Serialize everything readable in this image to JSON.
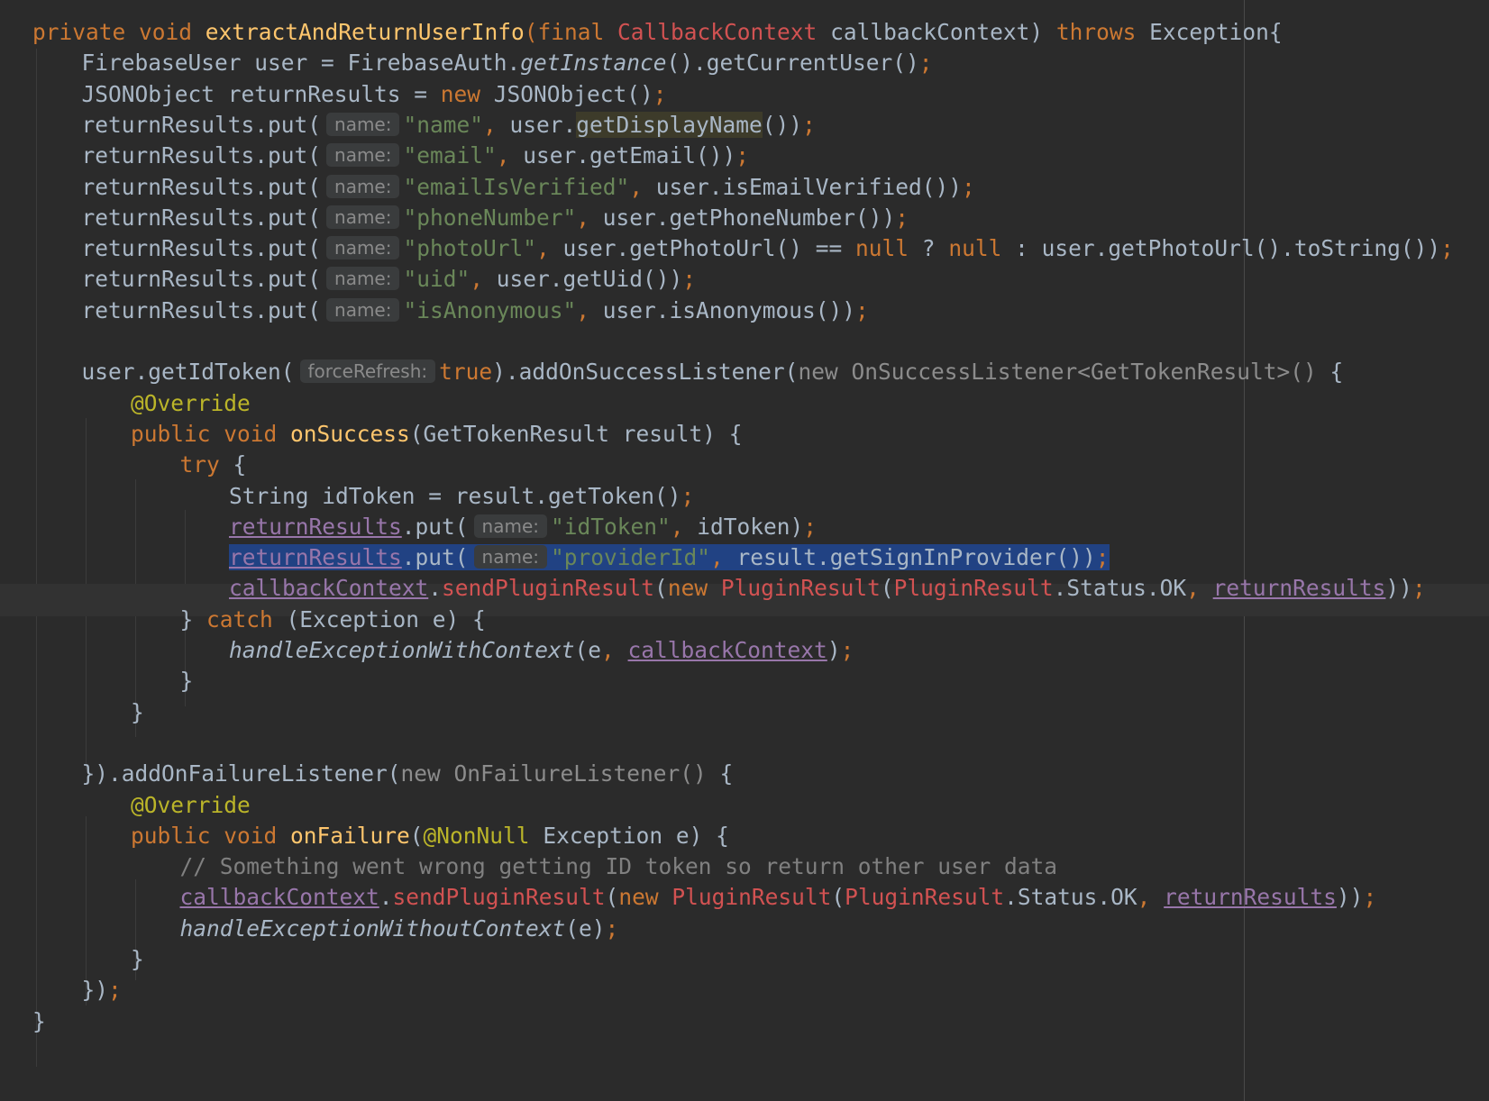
{
  "editor": {
    "language": "java",
    "lines": [
      [
        {
          "s": "kw",
          "v": "private void "
        },
        {
          "s": "fn",
          "v": "extractAndReturnUserInfo"
        },
        {
          "s": "kw",
          "v": "(final "
        },
        {
          "s": "cls",
          "v": "CallbackContext"
        },
        {
          "s": "def",
          "v": " callbackContext) "
        },
        {
          "s": "kw",
          "v": "throws "
        },
        {
          "s": "def",
          "v": "Exception{"
        }
      ],
      [
        {
          "s": "def",
          "v": "FirebaseUser user = FirebaseAuth."
        },
        {
          "s": "ital",
          "v": "getInstance"
        },
        {
          "s": "def",
          "v": "().getCurrentUser()"
        },
        {
          "s": "kw",
          "v": ";"
        }
      ],
      [
        {
          "s": "def",
          "v": "JSONObject returnResults = "
        },
        {
          "s": "kw",
          "v": "new "
        },
        {
          "s": "def",
          "v": "JSONObject()"
        },
        {
          "s": "kw",
          "v": ";"
        }
      ],
      [
        {
          "s": "def",
          "v": "returnResults.put("
        },
        {
          "s": "hint",
          "v": "name:"
        },
        {
          "s": "str",
          "v": "\"name\""
        },
        {
          "s": "kw",
          "v": ", "
        },
        {
          "s": "def",
          "v": "user."
        },
        {
          "s": "usage",
          "v": "getDisplayName"
        },
        {
          "s": "def",
          "v": "())"
        },
        {
          "s": "kw",
          "v": ";"
        }
      ],
      [
        {
          "s": "def",
          "v": "returnResults.put("
        },
        {
          "s": "hint",
          "v": "name:"
        },
        {
          "s": "str",
          "v": "\"email\""
        },
        {
          "s": "kw",
          "v": ", "
        },
        {
          "s": "def",
          "v": "user.getEmail())"
        },
        {
          "s": "kw",
          "v": ";"
        }
      ],
      [
        {
          "s": "def",
          "v": "returnResults.put("
        },
        {
          "s": "hint",
          "v": "name:"
        },
        {
          "s": "str",
          "v": "\"emailIsVerified\""
        },
        {
          "s": "kw",
          "v": ", "
        },
        {
          "s": "def",
          "v": "user.isEmailVerified())"
        },
        {
          "s": "kw",
          "v": ";"
        }
      ],
      [
        {
          "s": "def",
          "v": "returnResults.put("
        },
        {
          "s": "hint",
          "v": "name:"
        },
        {
          "s": "str",
          "v": "\"phoneNumber\""
        },
        {
          "s": "kw",
          "v": ", "
        },
        {
          "s": "def",
          "v": "user.getPhoneNumber())"
        },
        {
          "s": "kw",
          "v": ";"
        }
      ],
      [
        {
          "s": "def",
          "v": "returnResults.put("
        },
        {
          "s": "hint",
          "v": "name:"
        },
        {
          "s": "str",
          "v": "\"photoUrl\""
        },
        {
          "s": "kw",
          "v": ", "
        },
        {
          "s": "def",
          "v": "user.getPhotoUrl() == "
        },
        {
          "s": "kw",
          "v": "null "
        },
        {
          "s": "def",
          "v": "? "
        },
        {
          "s": "kw",
          "v": "null "
        },
        {
          "s": "def",
          "v": ": user.getPhotoUrl().toString())"
        },
        {
          "s": "kw",
          "v": ";"
        }
      ],
      [
        {
          "s": "def",
          "v": "returnResults.put("
        },
        {
          "s": "hint",
          "v": "name:"
        },
        {
          "s": "str",
          "v": "\"uid\""
        },
        {
          "s": "kw",
          "v": ", "
        },
        {
          "s": "def",
          "v": "user.getUid())"
        },
        {
          "s": "kw",
          "v": ";"
        }
      ],
      [
        {
          "s": "def",
          "v": "returnResults.put("
        },
        {
          "s": "hint",
          "v": "name:"
        },
        {
          "s": "str",
          "v": "\"isAnonymous\""
        },
        {
          "s": "kw",
          "v": ", "
        },
        {
          "s": "def",
          "v": "user.isAnonymous())"
        },
        {
          "s": "kw",
          "v": ";"
        }
      ],
      [],
      [
        {
          "s": "def",
          "v": "user.getIdToken("
        },
        {
          "s": "hint",
          "v": "forceRefresh:"
        },
        {
          "s": "kw",
          "v": "true"
        },
        {
          "s": "def",
          "v": ").addOnSuccessListener("
        },
        {
          "s": "dim",
          "v": "new OnSuccessListener<GetTokenResult>() "
        },
        {
          "s": "def",
          "v": "{"
        }
      ],
      [
        {
          "s": "ann",
          "v": "@Override"
        }
      ],
      [
        {
          "s": "kw",
          "v": "public void "
        },
        {
          "s": "fn",
          "v": "onSuccess"
        },
        {
          "s": "def",
          "v": "(GetTokenResult result) {"
        }
      ],
      [
        {
          "s": "kw",
          "v": "try "
        },
        {
          "s": "def",
          "v": "{"
        }
      ],
      [
        {
          "s": "def",
          "v": "String idToken = result.getToken()"
        },
        {
          "s": "kw",
          "v": ";"
        }
      ],
      [
        {
          "s": "field",
          "v": "returnResults"
        },
        {
          "s": "def",
          "v": ".put("
        },
        {
          "s": "hint",
          "v": "name:"
        },
        {
          "s": "str",
          "v": "\"idToken\""
        },
        {
          "s": "kw",
          "v": ", "
        },
        {
          "s": "def",
          "v": "idToken)"
        },
        {
          "s": "kw",
          "v": ";"
        }
      ],
      [
        {
          "s": "field",
          "v": "returnResults"
        },
        {
          "s": "def",
          "v": ".put("
        },
        {
          "s": "hint",
          "v": "name:"
        },
        {
          "s": "str",
          "v": "\"providerId\""
        },
        {
          "s": "kw",
          "v": ", "
        },
        {
          "s": "def",
          "v": "result.getSignInProvider())"
        },
        {
          "s": "kw",
          "v": ";"
        }
      ],
      [
        {
          "s": "field",
          "v": "callbackContext"
        },
        {
          "s": "def",
          "v": "."
        },
        {
          "s": "cls",
          "v": "sendPluginResult"
        },
        {
          "s": "def",
          "v": "("
        },
        {
          "s": "kw",
          "v": "new "
        },
        {
          "s": "cls",
          "v": "PluginResult"
        },
        {
          "s": "def",
          "v": "("
        },
        {
          "s": "cls",
          "v": "PluginResult"
        },
        {
          "s": "def",
          "v": ".Status.OK"
        },
        {
          "s": "kw",
          "v": ", "
        },
        {
          "s": "field",
          "v": "returnResults"
        },
        {
          "s": "def",
          "v": "))"
        },
        {
          "s": "kw",
          "v": ";"
        }
      ],
      [
        {
          "s": "def",
          "v": "} "
        },
        {
          "s": "kw",
          "v": "catch "
        },
        {
          "s": "def",
          "v": "(Exception e) {"
        }
      ],
      [
        {
          "s": "ital",
          "v": "handleExceptionWithContext"
        },
        {
          "s": "def",
          "v": "(e"
        },
        {
          "s": "kw",
          "v": ", "
        },
        {
          "s": "field",
          "v": "callbackContext"
        },
        {
          "s": "def",
          "v": ")"
        },
        {
          "s": "kw",
          "v": ";"
        }
      ],
      [
        {
          "s": "def",
          "v": "}"
        }
      ],
      [
        {
          "s": "def",
          "v": "}"
        }
      ],
      [],
      [
        {
          "s": "def",
          "v": "}).addOnFailureListener("
        },
        {
          "s": "dim",
          "v": "new OnFailureListener() "
        },
        {
          "s": "def",
          "v": "{"
        }
      ],
      [
        {
          "s": "ann",
          "v": "@Override"
        }
      ],
      [
        {
          "s": "kw",
          "v": "public void "
        },
        {
          "s": "fn",
          "v": "onFailure"
        },
        {
          "s": "def",
          "v": "("
        },
        {
          "s": "ann",
          "v": "@NonNull "
        },
        {
          "s": "def",
          "v": "Exception e) {"
        }
      ],
      [
        {
          "s": "cmt",
          "v": "// Something went wrong getting ID token so return other user data"
        }
      ],
      [
        {
          "s": "field",
          "v": "callbackContext"
        },
        {
          "s": "def",
          "v": "."
        },
        {
          "s": "cls",
          "v": "sendPluginResult"
        },
        {
          "s": "def",
          "v": "("
        },
        {
          "s": "kw",
          "v": "new "
        },
        {
          "s": "cls",
          "v": "PluginResult"
        },
        {
          "s": "def",
          "v": "("
        },
        {
          "s": "cls",
          "v": "PluginResult"
        },
        {
          "s": "def",
          "v": ".Status.OK"
        },
        {
          "s": "kw",
          "v": ", "
        },
        {
          "s": "field",
          "v": "returnResults"
        },
        {
          "s": "def",
          "v": "))"
        },
        {
          "s": "kw",
          "v": ";"
        }
      ],
      [
        {
          "s": "ital",
          "v": "handleExceptionWithoutContext"
        },
        {
          "s": "def",
          "v": "(e)"
        },
        {
          "s": "kw",
          "v": ";"
        }
      ],
      [
        {
          "s": "def",
          "v": "}"
        }
      ],
      [
        {
          "s": "def",
          "v": "})"
        },
        {
          "s": "kw",
          "v": ";"
        }
      ],
      [
        {
          "s": "def",
          "v": "}"
        }
      ]
    ],
    "indents": [
      0,
      1,
      1,
      1,
      1,
      1,
      1,
      1,
      1,
      1,
      0,
      1,
      2,
      2,
      3,
      4,
      4,
      4,
      4,
      3,
      4,
      3,
      2,
      0,
      1,
      2,
      2,
      3,
      3,
      3,
      2,
      1,
      0
    ],
    "caret_line": 17,
    "selected_line": 17,
    "colors": {
      "background": "#2b2b2b",
      "default": "#a9b7c6",
      "keyword": "#cc7832",
      "function": "#ffc66d",
      "string": "#6a8759",
      "annotation": "#bbb529",
      "class_ref": "#d25252",
      "field": "#9876aa",
      "comment": "#808080",
      "dimmed": "#8c8c8c",
      "hint_text": "#8a8a8a",
      "selection": "#214283",
      "usage_highlight": "#3d3b2a"
    }
  }
}
